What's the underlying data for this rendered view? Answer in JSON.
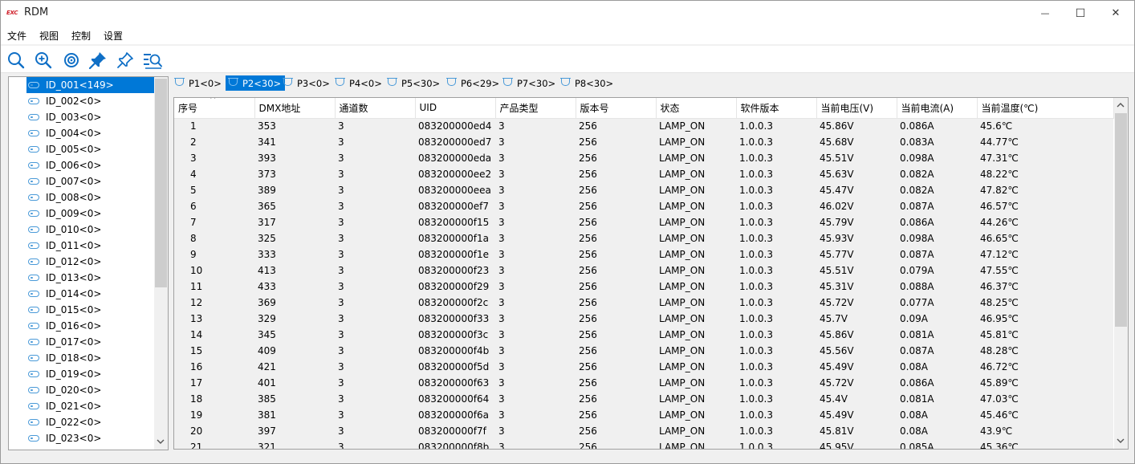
{
  "window": {
    "logo_text": "EXC",
    "title": "RDM",
    "minimize_glyph": "—",
    "maximize_glyph": "☐",
    "close_glyph": "✕"
  },
  "menu": [
    "文件",
    "视图",
    "控制",
    "设置"
  ],
  "toolbar": {
    "buttons": [
      "search-icon",
      "zoom-in-icon",
      "target-icon",
      "pin-filled-icon",
      "pin-outline-icon",
      "list-search-icon"
    ],
    "accent_color": "#0f6fc6"
  },
  "tree": {
    "items": [
      "ID_001<149>",
      "ID_002<0>",
      "ID_003<0>",
      "ID_004<0>",
      "ID_005<0>",
      "ID_006<0>",
      "ID_007<0>",
      "ID_008<0>",
      "ID_009<0>",
      "ID_010<0>",
      "ID_011<0>",
      "ID_012<0>",
      "ID_013<0>",
      "ID_014<0>",
      "ID_015<0>",
      "ID_016<0>",
      "ID_017<0>",
      "ID_018<0>",
      "ID_019<0>",
      "ID_020<0>",
      "ID_021<0>",
      "ID_022<0>",
      "ID_023<0>"
    ],
    "selected_index": 0
  },
  "tabs": {
    "items": [
      "P1<0>",
      "P2<30>",
      "P3<0>",
      "P4<0>",
      "P5<30>",
      "P6<29>",
      "P7<30>",
      "P8<30>"
    ],
    "active_index": 1,
    "selected_color": "#0078d7"
  },
  "table": {
    "columns": [
      "序号",
      "DMX地址",
      "通道数",
      "UID",
      "产品类型",
      "版本号",
      "状态",
      "软件版本",
      "当前电压(V)",
      "当前电流(A)",
      "当前温度(℃)"
    ],
    "sort_glyph": "^",
    "rows": [
      [
        "1",
        "353",
        "3",
        "083200000ed4",
        "3",
        "256",
        "LAMP_ON",
        "1.0.0.3",
        "45.86V",
        "0.086A",
        "45.6℃"
      ],
      [
        "2",
        "341",
        "3",
        "083200000ed7",
        "3",
        "256",
        "LAMP_ON",
        "1.0.0.3",
        "45.68V",
        "0.083A",
        "44.77℃"
      ],
      [
        "3",
        "393",
        "3",
        "083200000eda",
        "3",
        "256",
        "LAMP_ON",
        "1.0.0.3",
        "45.51V",
        "0.098A",
        "47.31℃"
      ],
      [
        "4",
        "373",
        "3",
        "083200000ee2",
        "3",
        "256",
        "LAMP_ON",
        "1.0.0.3",
        "45.63V",
        "0.082A",
        "48.22℃"
      ],
      [
        "5",
        "389",
        "3",
        "083200000eea",
        "3",
        "256",
        "LAMP_ON",
        "1.0.0.3",
        "45.47V",
        "0.082A",
        "47.82℃"
      ],
      [
        "6",
        "365",
        "3",
        "083200000ef7",
        "3",
        "256",
        "LAMP_ON",
        "1.0.0.3",
        "46.02V",
        "0.087A",
        "46.57℃"
      ],
      [
        "7",
        "317",
        "3",
        "083200000f15",
        "3",
        "256",
        "LAMP_ON",
        "1.0.0.3",
        "45.79V",
        "0.086A",
        "44.26℃"
      ],
      [
        "8",
        "325",
        "3",
        "083200000f1a",
        "3",
        "256",
        "LAMP_ON",
        "1.0.0.3",
        "45.93V",
        "0.098A",
        "46.65℃"
      ],
      [
        "9",
        "333",
        "3",
        "083200000f1e",
        "3",
        "256",
        "LAMP_ON",
        "1.0.0.3",
        "45.77V",
        "0.087A",
        "47.12℃"
      ],
      [
        "10",
        "413",
        "3",
        "083200000f23",
        "3",
        "256",
        "LAMP_ON",
        "1.0.0.3",
        "45.51V",
        "0.079A",
        "47.55℃"
      ],
      [
        "11",
        "433",
        "3",
        "083200000f29",
        "3",
        "256",
        "LAMP_ON",
        "1.0.0.3",
        "45.31V",
        "0.088A",
        "46.37℃"
      ],
      [
        "12",
        "369",
        "3",
        "083200000f2c",
        "3",
        "256",
        "LAMP_ON",
        "1.0.0.3",
        "45.72V",
        "0.077A",
        "48.25℃"
      ],
      [
        "13",
        "329",
        "3",
        "083200000f33",
        "3",
        "256",
        "LAMP_ON",
        "1.0.0.3",
        "45.7V",
        "0.09A",
        "46.95℃"
      ],
      [
        "14",
        "345",
        "3",
        "083200000f3c",
        "3",
        "256",
        "LAMP_ON",
        "1.0.0.3",
        "45.86V",
        "0.081A",
        "45.81℃"
      ],
      [
        "15",
        "409",
        "3",
        "083200000f4b",
        "3",
        "256",
        "LAMP_ON",
        "1.0.0.3",
        "45.56V",
        "0.087A",
        "48.28℃"
      ],
      [
        "16",
        "421",
        "3",
        "083200000f5d",
        "3",
        "256",
        "LAMP_ON",
        "1.0.0.3",
        "45.49V",
        "0.08A",
        "46.72℃"
      ],
      [
        "17",
        "401",
        "3",
        "083200000f63",
        "3",
        "256",
        "LAMP_ON",
        "1.0.0.3",
        "45.72V",
        "0.086A",
        "45.89℃"
      ],
      [
        "18",
        "385",
        "3",
        "083200000f64",
        "3",
        "256",
        "LAMP_ON",
        "1.0.0.3",
        "45.4V",
        "0.081A",
        "47.03℃"
      ],
      [
        "19",
        "381",
        "3",
        "083200000f6a",
        "3",
        "256",
        "LAMP_ON",
        "1.0.0.3",
        "45.49V",
        "0.08A",
        "45.46℃"
      ],
      [
        "20",
        "397",
        "3",
        "083200000f7f",
        "3",
        "256",
        "LAMP_ON",
        "1.0.0.3",
        "45.81V",
        "0.08A",
        "43.9℃"
      ],
      [
        "21",
        "321",
        "3",
        "083200000f8b",
        "3",
        "256",
        "LAMP_ON",
        "1.0.0.3",
        "45.95V",
        "0.085A",
        "45.36℃"
      ]
    ]
  }
}
